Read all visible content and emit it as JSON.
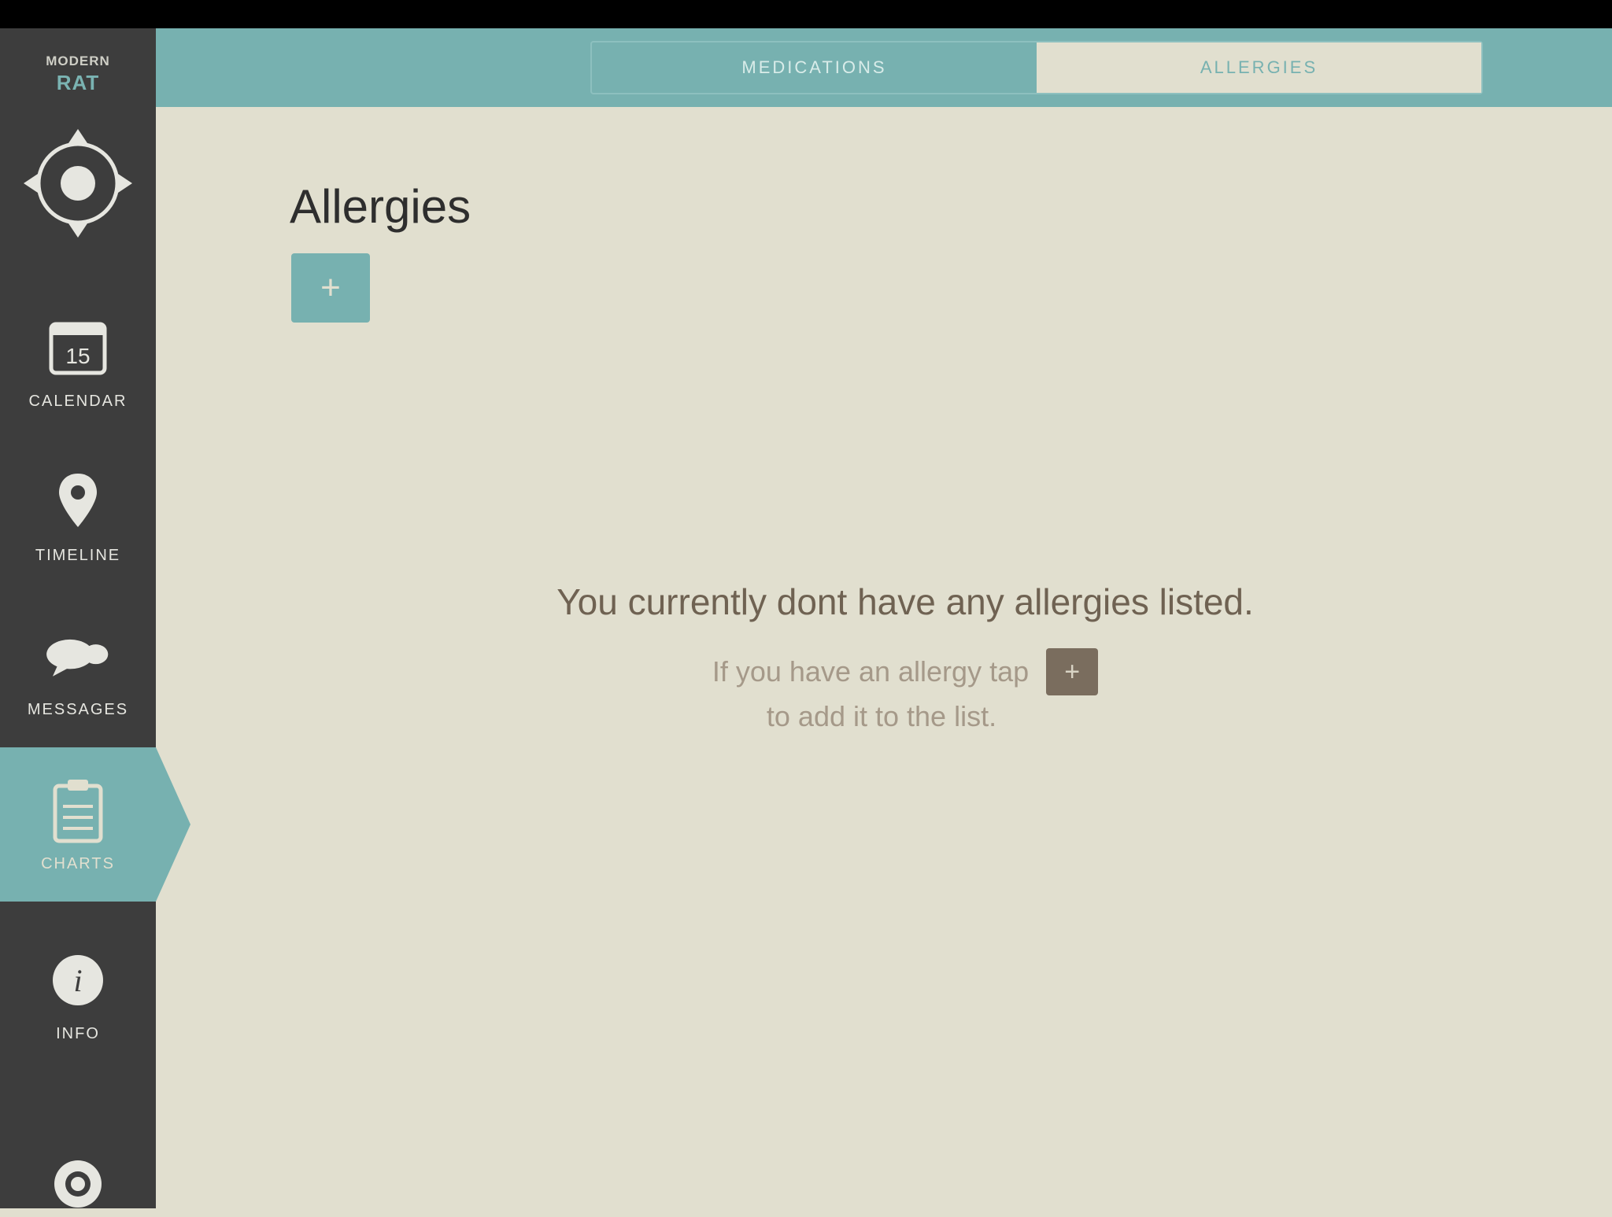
{
  "app": {
    "logo_line1": "MODERN",
    "logo_line2": "RAT"
  },
  "sidebar": {
    "items": [
      {
        "label": "Calendar",
        "icon": "calendar-icon"
      },
      {
        "label": "Timeline",
        "icon": "map-pin-icon"
      },
      {
        "label": "Messages",
        "icon": "chat-bubble-icon"
      },
      {
        "label": "Charts",
        "icon": "clipboard-icon",
        "active": true
      },
      {
        "label": "Info",
        "icon": "info-icon"
      }
    ],
    "settings_icon": "gear-icon"
  },
  "topbar": {
    "tabs": [
      {
        "label": "Medications",
        "active": false
      },
      {
        "label": "Allergies",
        "active": true
      }
    ]
  },
  "main": {
    "title": "Allergies",
    "add_label": "+",
    "empty_headline": "You currently dont have any allergies listed.",
    "empty_line2": "If you have an allergy tap",
    "empty_button": "+",
    "empty_line3": "to add it to the list."
  },
  "colors": {
    "accent": "#77b1b0",
    "sidebar": "#3d3d3d",
    "background": "#e1dfcf",
    "text_brown": "#6f6252"
  }
}
